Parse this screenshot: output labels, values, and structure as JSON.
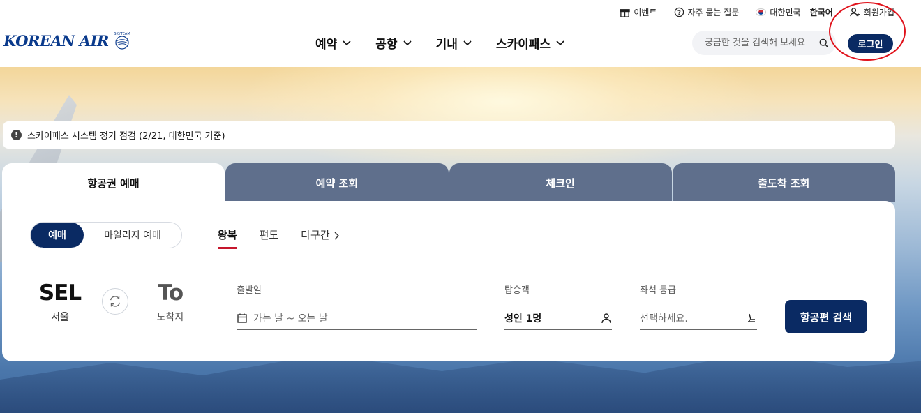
{
  "util": {
    "events": "이벤트",
    "faq": "자주 묻는 질문",
    "country": "대한민국 - ",
    "language": "한국어",
    "signup": "회원가입"
  },
  "brand": {
    "logo_text": "KOREAN AIR",
    "logo_sub": "SKYTEAM"
  },
  "nav": {
    "items": [
      "예약",
      "공항",
      "기내",
      "스카이패스"
    ]
  },
  "search": {
    "placeholder": "궁금한 것을 검색해 보세요"
  },
  "login": "로그인",
  "notice": "스카이패스 시스템 정기 점검 (2/21, 대한민국 기준)",
  "tabs": [
    "항공권 예매",
    "예약 조회",
    "체크인",
    "출도착 조회"
  ],
  "booking": {
    "mode": [
      "예매",
      "마일리지 예매"
    ],
    "trip_types": [
      "왕복",
      "편도",
      "다구간"
    ],
    "from": {
      "code": "SEL",
      "name": "서울"
    },
    "to": {
      "code": "To",
      "name": "도착지"
    },
    "date": {
      "label": "출발일",
      "placeholder": "가는 날 ~ 오는 날"
    },
    "passengers": {
      "label": "탑승객",
      "value": "성인 1명"
    },
    "cabin": {
      "label": "좌석 등급",
      "placeholder": "선택하세요."
    },
    "submit": "항공편 검색"
  },
  "colors": {
    "brand_navy": "#0a2a63",
    "tab_inactive": "#5f6f8c",
    "accent_red": "#c6172d",
    "highlight_ring": "#e0121b"
  }
}
